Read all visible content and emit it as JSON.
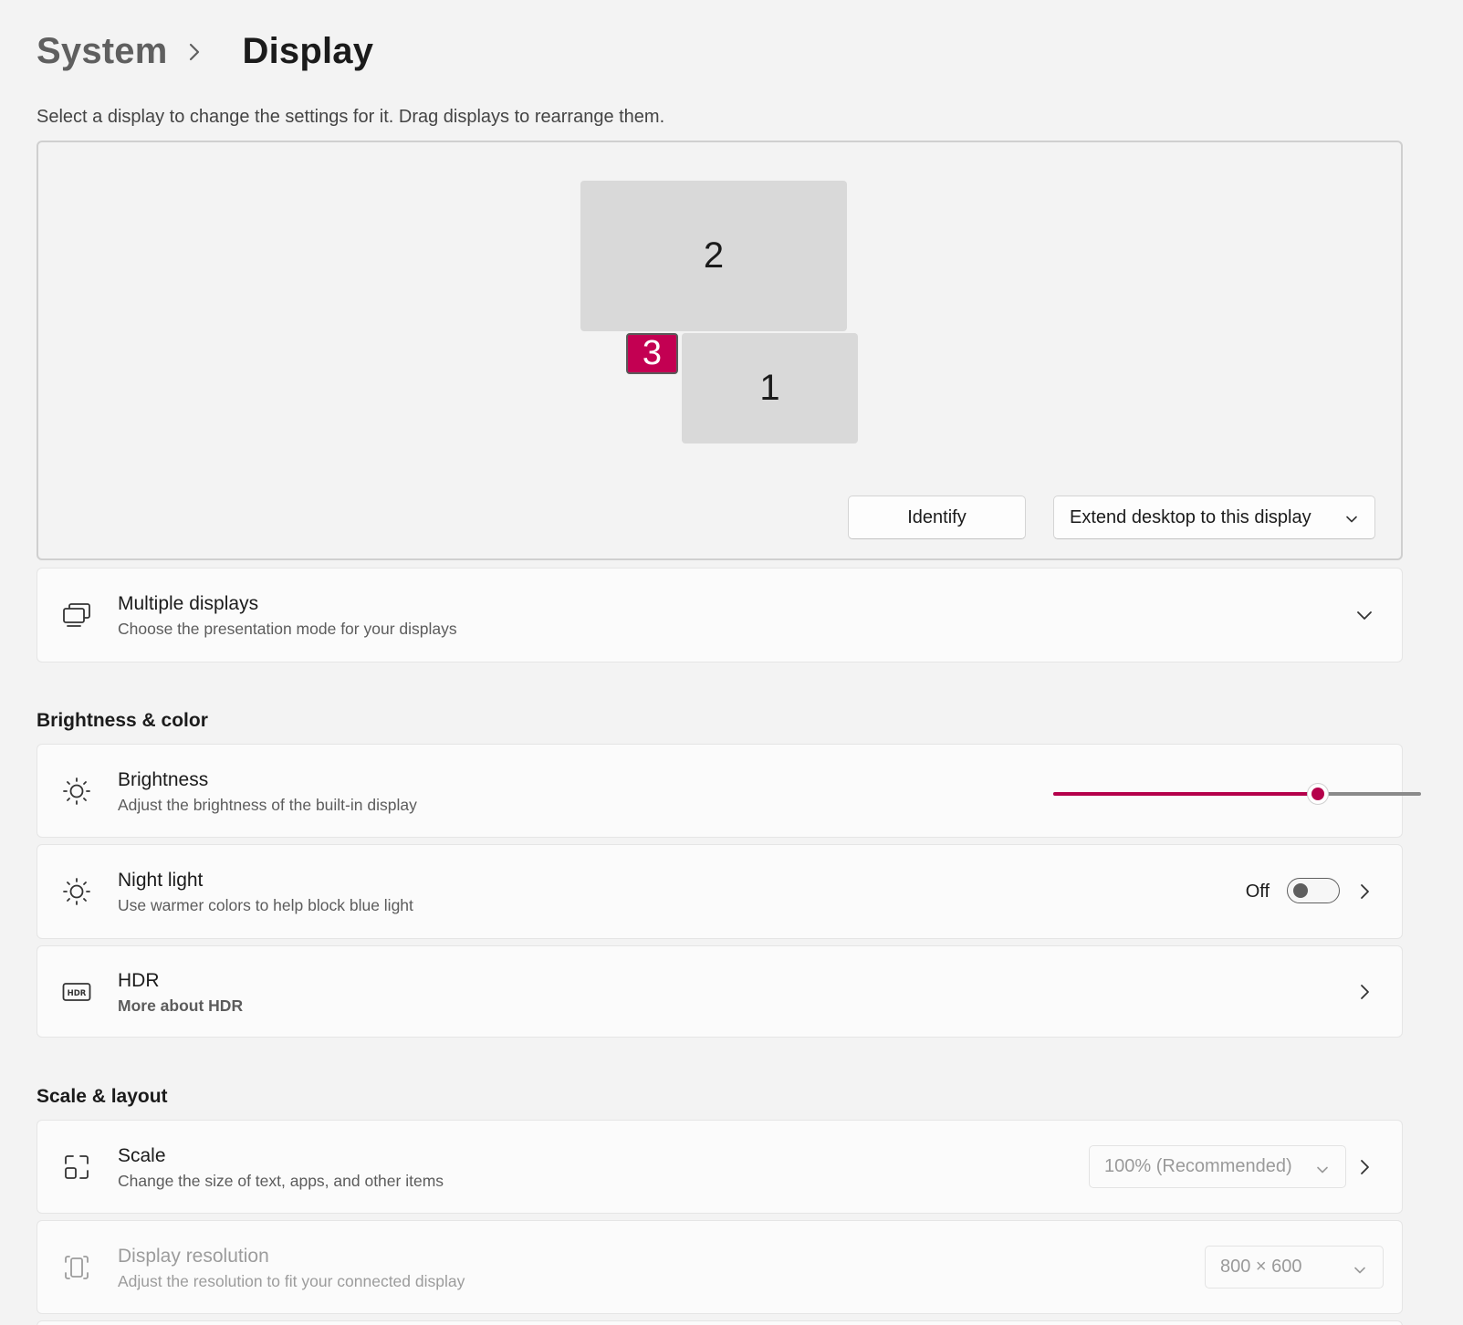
{
  "breadcrumb": {
    "parent": "System",
    "current": "Display"
  },
  "intro": "Select a display to change the settings for it. Drag displays to rearrange them.",
  "arrangement": {
    "monitors": [
      {
        "label": "2",
        "selected": false
      },
      {
        "label": "1",
        "selected": false
      },
      {
        "label": "3",
        "selected": true
      }
    ],
    "identify_label": "Identify",
    "mode_label": "Extend desktop to this display"
  },
  "multiple_displays": {
    "title": "Multiple displays",
    "subtitle": "Choose the presentation mode for your displays"
  },
  "brightness_section": {
    "heading": "Brightness & color",
    "brightness": {
      "title": "Brightness",
      "subtitle": "Adjust the brightness of the built-in display",
      "value_percent": 72
    },
    "night_light": {
      "title": "Night light",
      "subtitle": "Use warmer colors to help block blue light",
      "state": "Off"
    },
    "hdr": {
      "title": "HDR",
      "link": "More about HDR"
    }
  },
  "scale_section": {
    "heading": "Scale & layout",
    "scale": {
      "title": "Scale",
      "subtitle": "Change the size of text, apps, and other items",
      "value": "100% (Recommended)"
    },
    "resolution": {
      "title": "Display resolution",
      "subtitle": "Adjust the resolution to fit your connected display",
      "value": "800 × 600"
    }
  },
  "colors": {
    "accent": "#c30052",
    "slider_accent": "#b5004b",
    "link": "#8b0a3a",
    "background": "#f3f3f3",
    "card": "#fbfbfb"
  }
}
